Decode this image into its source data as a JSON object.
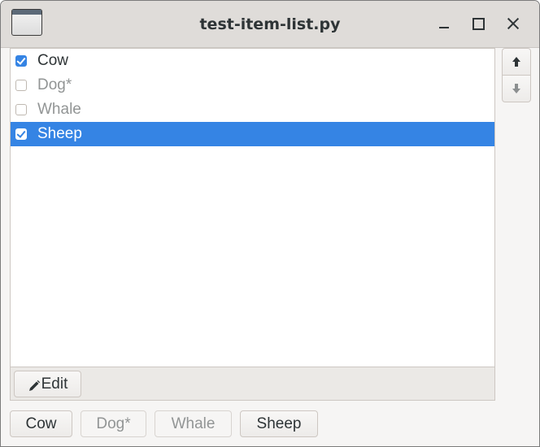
{
  "window": {
    "title": "test-item-list.py"
  },
  "list": {
    "items": [
      {
        "label": "Cow",
        "checked": true,
        "inactive": false,
        "selected": false
      },
      {
        "label": "Dog*",
        "checked": false,
        "inactive": true,
        "selected": false
      },
      {
        "label": "Whale",
        "checked": false,
        "inactive": true,
        "selected": false
      },
      {
        "label": "Sheep",
        "checked": true,
        "inactive": false,
        "selected": true
      }
    ],
    "edit_label": "Edit"
  },
  "bottom_buttons": [
    {
      "label": "Cow",
      "enabled": true
    },
    {
      "label": "Dog*",
      "enabled": false
    },
    {
      "label": "Whale",
      "enabled": false
    },
    {
      "label": "Sheep",
      "enabled": true
    }
  ],
  "icons": {
    "app": "app-window-icon",
    "minimize": "minimize-icon",
    "maximize": "maximize-icon",
    "close": "close-icon",
    "edit": "pencil-icon",
    "move_up": "arrow-up-icon",
    "move_down": "arrow-down-icon"
  },
  "colors": {
    "accent": "#3584e4",
    "titlebar": "#dfdcd9",
    "disabled_text": "#929595"
  }
}
